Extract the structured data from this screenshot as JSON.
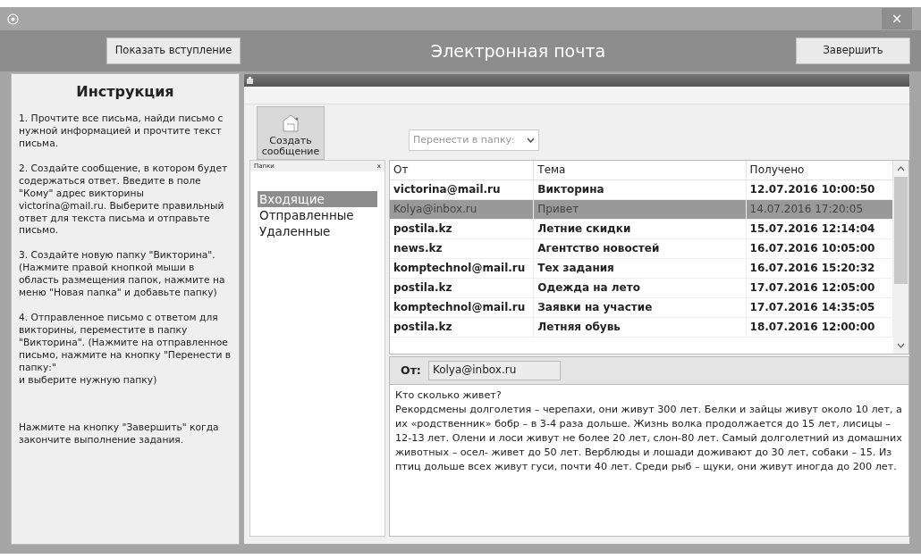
{
  "window": {
    "close": "×"
  },
  "header": {
    "intro_button": "Показать вступление",
    "title": "Электронная почта",
    "finish_button": "Завершить"
  },
  "instructions": {
    "title": "Инструкция",
    "paragraphs": [
      "1. Прочтите все письма, найди письмо с нужной информацией и прочтите текст письма.",
      "2. Создайте сообщение, в котором будет содержаться ответ. Введите в поле \"Кому\" адрес викторины victorina@mail.ru. Выберите правильный ответ для текста письма и отправьте письмо.",
      "3. Создайте новую папку \"Викторина\". (Нажмите правой кнопкой мыши в область размещения папок, нажмите на меню \"Новая папка\" и добавьте папку)",
      "4. Отправленное письмо с ответом для викторины, переместите в папку \"Викторина\". (Нажмите на отправленное письмо, нажмите на кнопку \"Перенести в папку:\"\nи выберите нужную папку)",
      "Нажмите на  кнопку \"Завершить\" когда закончите выполнение задания."
    ]
  },
  "toolbar": {
    "create_button": "Создать сообщение",
    "move_dropdown": {
      "placeholder": "Перенести в папку:"
    }
  },
  "folders": {
    "title": "Папки",
    "close": "x",
    "items": [
      {
        "label": "Входящие",
        "selected": true
      },
      {
        "label": "Отправленные",
        "selected": false
      },
      {
        "label": "Удаленные",
        "selected": false
      }
    ]
  },
  "messages": {
    "columns": [
      "От",
      "Тема",
      "Получено"
    ],
    "rows": [
      {
        "from": "victorina@mail.ru",
        "subject": "Викторина",
        "received": "12.07.2016 10:00:50",
        "unread": true,
        "selected": false
      },
      {
        "from": "Kolya@inbox.ru",
        "subject": "Привет",
        "received": "14.07.2016 17:20:05",
        "unread": false,
        "selected": true
      },
      {
        "from": "postila.kz",
        "subject": "Летние скидки",
        "received": "15.07.2016 12:14:04",
        "unread": true,
        "selected": false
      },
      {
        "from": "news.kz",
        "subject": "Агентство новостей",
        "received": "16.07.2016 10:05:00",
        "unread": true,
        "selected": false
      },
      {
        "from": "komptechnol@mail.ru",
        "subject": "Тех задания",
        "received": "16.07.2016 15:20:32",
        "unread": true,
        "selected": false
      },
      {
        "from": "postila.kz",
        "subject": "Одежда на лето",
        "received": "17.07.2016 12:05:00",
        "unread": true,
        "selected": false
      },
      {
        "from": "komptechnol@mail.ru",
        "subject": "Заявки на участие",
        "received": "17.07.2016 14:35:05",
        "unread": true,
        "selected": false
      },
      {
        "from": "postila.kz",
        "subject": "Летняя обувь",
        "received": "18.07.2016 12:00:00",
        "unread": true,
        "selected": false
      }
    ]
  },
  "preview": {
    "from_label": "От:",
    "from_value": "Kolya@inbox.ru",
    "body": [
      "Кто сколько живет?",
      "Рекордсмены долголетия – черепахи, они живут 300 лет. Белки и зайцы живут около 10 лет, а их «родственник» бобр – в 3-4 раза дольше. Жизнь волка продолжается до 15 лет, лисицы – 12-13 лет. Олени и лоси живут не более 20 лет, слон-80 лет. Самый долголетний из домашних животных – осел- живет до 50 лет. Верблюды и лошади доживают до 30 лет, собаки – 15. Из птиц дольше всех живут гуси, почти 40 лет. Среди рыб – щуки, они живут иногда до 200 лет."
    ]
  }
}
